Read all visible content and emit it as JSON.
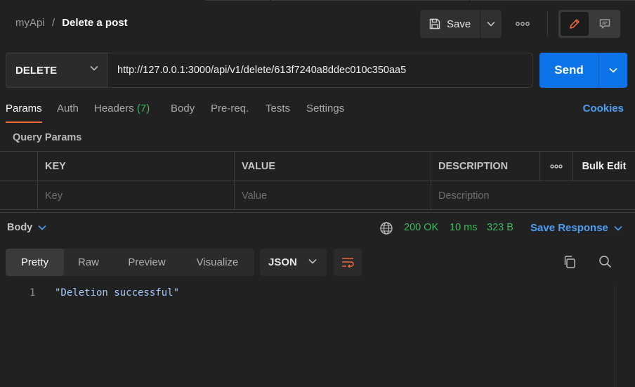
{
  "breadcrumb": {
    "workspace": "myApi",
    "separator": "/",
    "current": "Delete a post"
  },
  "header": {
    "save_label": "Save"
  },
  "request": {
    "method": "DELETE",
    "url": "http://127.0.0.1:3000/api/v1/delete/613f7240a8ddec010c350aa5",
    "send_label": "Send"
  },
  "tabs": [
    {
      "label": "Params",
      "active": true
    },
    {
      "label": "Auth"
    },
    {
      "label": "Headers",
      "count": "(7)"
    },
    {
      "label": "Body"
    },
    {
      "label": "Pre-req."
    },
    {
      "label": "Tests"
    },
    {
      "label": "Settings"
    }
  ],
  "cookies_label": "Cookies",
  "query_params": {
    "title": "Query Params",
    "columns": [
      "KEY",
      "VALUE",
      "DESCRIPTION"
    ],
    "bulk_edit": "Bulk Edit",
    "placeholders": [
      "Key",
      "Value",
      "Description"
    ]
  },
  "response": {
    "section_label": "Body",
    "status": "200 OK",
    "time": "10 ms",
    "size": "323 B",
    "save_response": "Save Response",
    "view_tabs": [
      "Pretty",
      "Raw",
      "Preview",
      "Visualize"
    ],
    "format": "JSON",
    "lines": [
      {
        "num": "1",
        "text": "\"Deletion successful\""
      }
    ]
  },
  "colors": {
    "accent_orange": "#f26b3a",
    "send_blue": "#0c73e8",
    "link_blue": "#4a9ff5",
    "status_green": "#3dba5c"
  }
}
